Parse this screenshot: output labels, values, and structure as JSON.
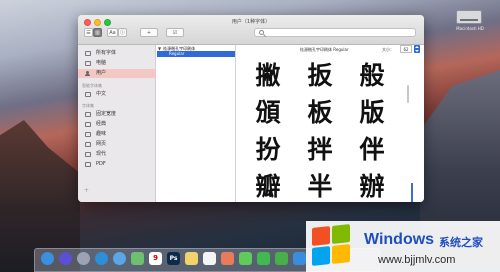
{
  "window": {
    "title": "用户（1种字体）",
    "toolbar": {
      "list_view": "☰",
      "grid_view": "▥",
      "aa": "Aa",
      "info": "ⓘ",
      "add": "+",
      "check": "☑",
      "search_placeholder": ""
    }
  },
  "sidebar": {
    "sections": [
      {
        "header": "",
        "items": [
          {
            "label": "所有字体",
            "icon": "font-collection-icon"
          },
          {
            "label": "电脑",
            "icon": "computer-icon"
          },
          {
            "label": "用户",
            "icon": "user-icon",
            "selected": true
          }
        ]
      },
      {
        "header": "智能字体集",
        "items": [
          {
            "label": "中文",
            "icon": "collection-icon"
          }
        ]
      },
      {
        "header": "字体集",
        "items": [
          {
            "label": "固定宽度",
            "icon": "collection-icon"
          },
          {
            "label": "经典",
            "icon": "collection-icon"
          },
          {
            "label": "趣味",
            "icon": "collection-icon"
          },
          {
            "label": "网页",
            "icon": "collection-icon"
          },
          {
            "label": "现代",
            "icon": "collection-icon"
          },
          {
            "label": "PDF",
            "icon": "collection-icon"
          }
        ]
      }
    ],
    "add_label": "+"
  },
  "fontlist": {
    "family": "桂源楷孔宇印刷体",
    "style": "Regular"
  },
  "preview": {
    "title": "桂源楷孔宇印刷体 Regular",
    "size_label": "大小：",
    "size_value": "62",
    "glyphs": [
      "撇",
      "扳",
      "般",
      "頒",
      "板",
      "版",
      "扮",
      "拌",
      "伴",
      "瓣",
      "半",
      "辦"
    ]
  },
  "desktop": {
    "disk_label": "Macintosh HD"
  },
  "dock": {
    "items": [
      {
        "name": "finder-icon",
        "color": "#3b8fe0",
        "text": ""
      },
      {
        "name": "siri-icon",
        "color": "#5b4fd6",
        "text": ""
      },
      {
        "name": "launchpad-icon",
        "color": "#9aa4b4",
        "text": ""
      },
      {
        "name": "safari-icon",
        "color": "#2d8fd8",
        "text": ""
      },
      {
        "name": "mail-icon",
        "color": "#5aa6e8",
        "text": ""
      },
      {
        "name": "maps-icon",
        "color": "#6cc070",
        "text": ""
      },
      {
        "name": "calendar-icon",
        "color": "#ffffff",
        "text": "9"
      },
      {
        "name": "photoshop-icon",
        "color": "#0c2b4b",
        "text": "Ps"
      },
      {
        "name": "notes-icon",
        "color": "#f2d26b",
        "text": ""
      },
      {
        "name": "reminders-icon",
        "color": "#f4f4f4",
        "text": ""
      },
      {
        "name": "photos-icon",
        "color": "#e87c5a",
        "text": ""
      },
      {
        "name": "messages-icon",
        "color": "#5ecb5b",
        "text": ""
      },
      {
        "name": "facetime-icon",
        "color": "#3fb950",
        "text": ""
      },
      {
        "name": "numbers-icon",
        "color": "#47b04b",
        "text": ""
      },
      {
        "name": "keynote-icon",
        "color": "#3a8ddc",
        "text": ""
      }
    ]
  },
  "watermark": {
    "brand": "Windows",
    "subtitle": "系统之家",
    "url": "www.bjjmlv.com",
    "colors": {
      "red": "#f25022",
      "green": "#7fba00",
      "blue": "#00a4ef",
      "yellow": "#ffb900"
    }
  }
}
